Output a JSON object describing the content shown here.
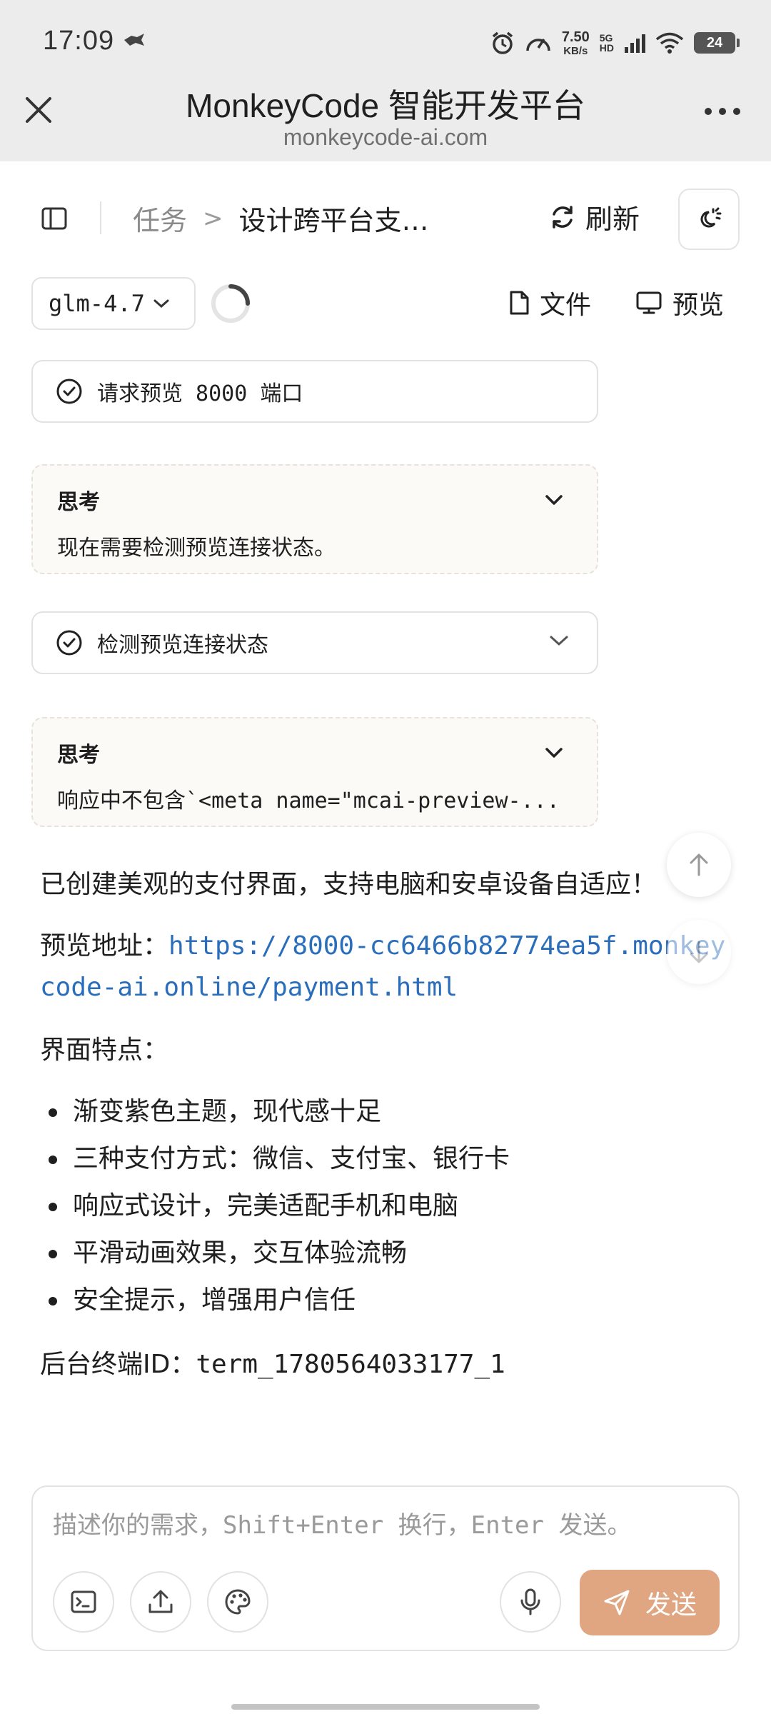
{
  "status_bar": {
    "time": "17:09",
    "net_speed_value": "7.50",
    "net_speed_unit": "KB/s",
    "network_top": "5G",
    "network_bottom": "HD",
    "battery": "24"
  },
  "browser": {
    "title": "MonkeyCode 智能开发平台",
    "url": "monkeycode-ai.com"
  },
  "header": {
    "breadcrumb_root": "任务",
    "breadcrumb_separator": ">",
    "breadcrumb_current": "设计跨平台支付...",
    "refresh_label": "刷新"
  },
  "toolbar": {
    "model": "glm-4.7",
    "files_label": "文件",
    "preview_label": "预览"
  },
  "messages": {
    "tool_1": "请求预览 8000 端口",
    "think_1": {
      "title": "思考",
      "body": "现在需要检测预览连接状态。"
    },
    "tool_2": "检测预览连接状态",
    "think_2": {
      "title": "思考",
      "body": "响应中不包含`<meta name=\"mcai-preview-..."
    }
  },
  "reply": {
    "intro": "已创建美观的支付界面，支持电脑和安卓设备自适应！",
    "preview_label": "预览地址：",
    "preview_url": "https://8000-cc6466b82774ea5f.monkeycode-ai.online/payment.html",
    "features_label": "界面特点：",
    "features": [
      "渐变紫色主题，现代感十足",
      "三种支付方式：微信、支付宝、银行卡",
      "响应式设计，完美适配手机和电脑",
      "平滑动画效果，交互体验流畅",
      "安全提示，增强用户信任"
    ],
    "terminal_label": "后台终端ID：",
    "terminal_id": "term_1780564033177_1"
  },
  "composer": {
    "placeholder": "描述你的需求，Shift+Enter 换行，Enter 发送。",
    "send_label": "发送"
  },
  "colors": {
    "accent": "#e0a682",
    "link": "#2a6ebb",
    "chrome_bg": "#ececec"
  }
}
